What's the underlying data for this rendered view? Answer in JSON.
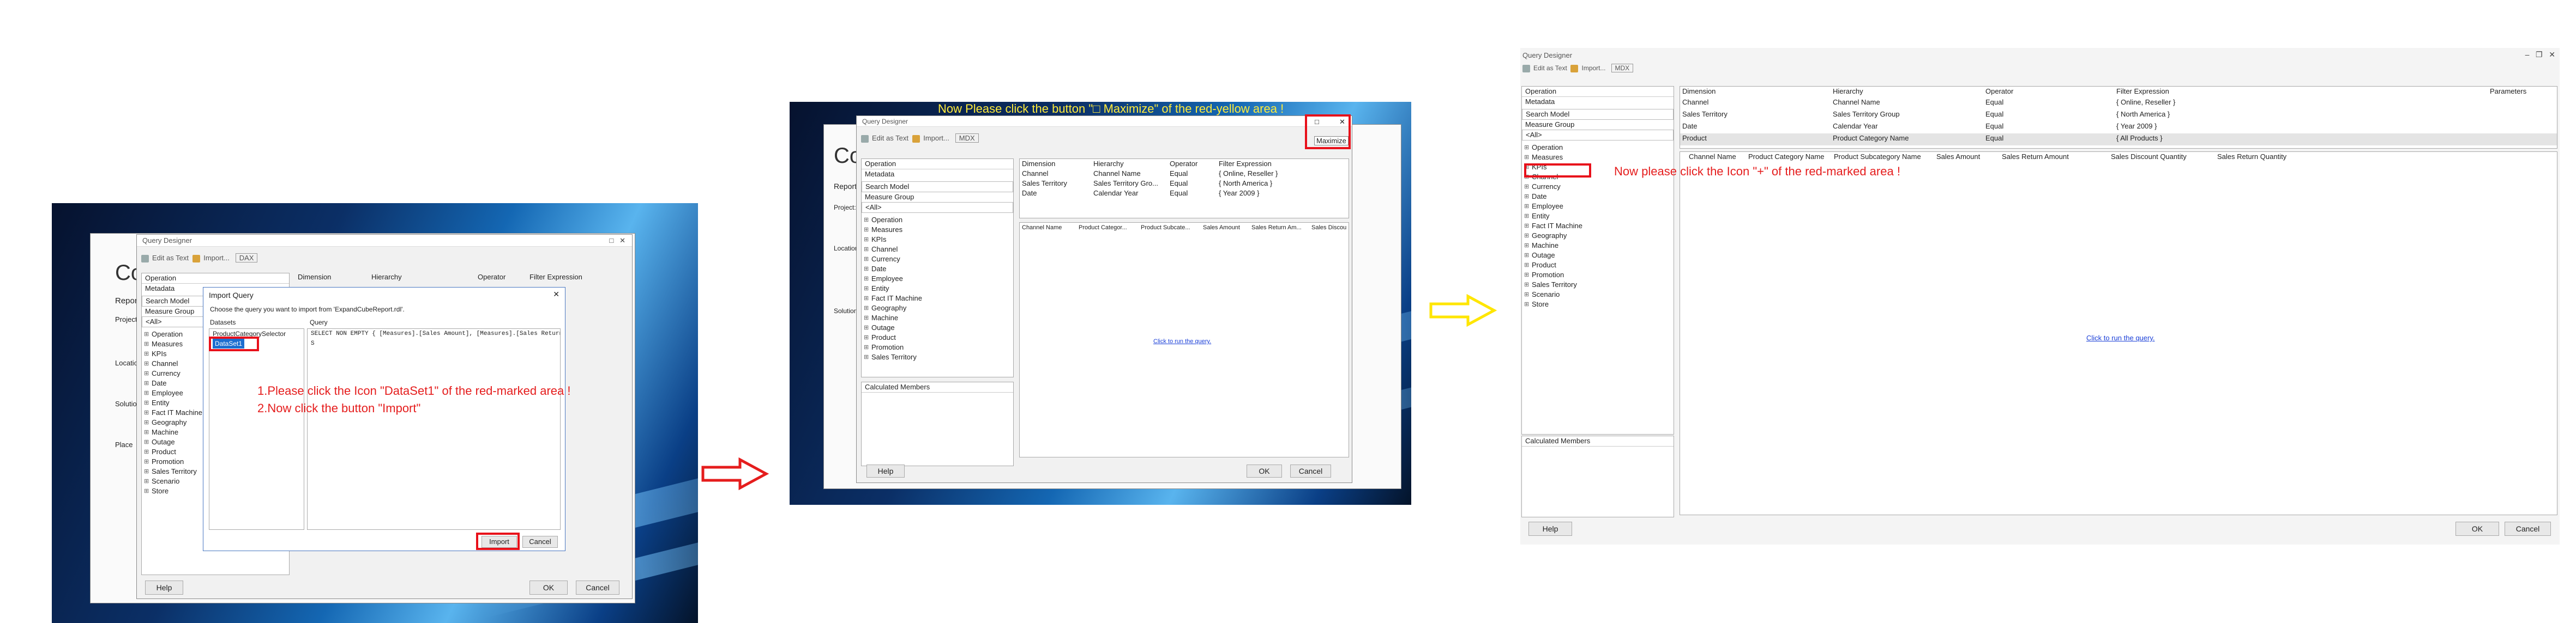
{
  "app": {
    "dialog_title": "Query Designer",
    "edit_as_text": "Edit as Text",
    "import": "Import...",
    "dax": "DAX",
    "mdx": "MDX"
  },
  "metadata": {
    "cube": "Operation",
    "metadata_tab": "Metadata",
    "search": "Search Model",
    "measure_group": "Measure Group",
    "all": "<All>",
    "tree": [
      "Operation",
      "Measures",
      "KPIs",
      "Channel",
      "Currency",
      "Date",
      "Employee",
      "Entity",
      "Fact IT Machine",
      "Geography",
      "Machine",
      "Outage",
      "Product",
      "Promotion",
      "Sales Territory",
      "Scenario",
      "Store"
    ]
  },
  "filter": {
    "headers": [
      "Dimension",
      "Hierarchy",
      "Operator",
      "Filter Expression",
      "Parameters"
    ],
    "rows": [
      [
        "Channel",
        "Channel Name",
        "Equal",
        "{ Online, Reseller }"
      ],
      [
        "Sales Territory",
        "Sales Territory Group",
        "Equal",
        "{ North America }"
      ],
      [
        "Date",
        "Calendar Year",
        "Equal",
        "{ Year 2009 }"
      ],
      [
        "Product",
        "Product Category Name",
        "Equal",
        "{ All Products }"
      ]
    ],
    "short_rows": [
      [
        "Channel",
        "Channel Name",
        "Equal",
        "{ Online, Reseller }"
      ],
      [
        "Sales Territory",
        "Sales Territory Gro...",
        "Equal",
        "{ North America }"
      ],
      [
        "Date",
        "Calendar Year",
        "Equal",
        "{ Year 2009 }"
      ]
    ]
  },
  "data_cols": [
    "Channel Name",
    "Product Category Name",
    "Product Subcategory Name",
    "Sales Amount",
    "Sales Return Amount",
    "Sales Discount Quantity",
    "Sales Return Quantity"
  ],
  "data_cols_short": [
    "Channel Name",
    "Product Categor...",
    "Product Subcate...",
    "Sales Amount",
    "Sales Return Am...",
    "Sales Discou"
  ],
  "run_query": "Click to run the query.",
  "calc_members": "Calculated Members",
  "buttons": {
    "help": "Help",
    "ok": "OK",
    "cancel": "Cancel",
    "import": "Import",
    "maximize": "Maximize"
  },
  "import_dialog": {
    "title": "Import Query",
    "instruction": "Choose the query you want to import from 'ExpandCubeReport.rdl'.",
    "datasets_label": "Datasets",
    "query_label": "Query",
    "dataset1": "DataSet1",
    "dataset_other": "ProductCategorySelector",
    "query_text": "SELECT NON EMPTY { [Measures].[Sales Amount], [Measures].[Sales Return Amount], [Measures].[Sales Discount Quantity] } ON COLUMNS",
    "query_line2": "S"
  },
  "background_form": {
    "title_partial": "Co",
    "report_label": "Report",
    "project_label": "Project:",
    "location_label": "Location:",
    "solution_label": "Solution:",
    "place_label": "Place"
  },
  "annotations": {
    "step1_line1": "1.Please  click  the Icon \"DataSet1\" of the red-marked area !",
    "step1_line2": "2.Now click the button \"Import\"",
    "step2": "Now  Please click the button \"□ Maximize\" of  the red-yellow area !",
    "step3": "Now please click the Icon \"+\" of the red-marked area !"
  },
  "colors": {
    "annotation_red": "#e51d1d",
    "annotation_yellow": "#ffeb3b",
    "arrow_red": "#e51d1d",
    "arrow_yellow": "#ffe600",
    "highlight_blue": "#1c6ed0"
  }
}
